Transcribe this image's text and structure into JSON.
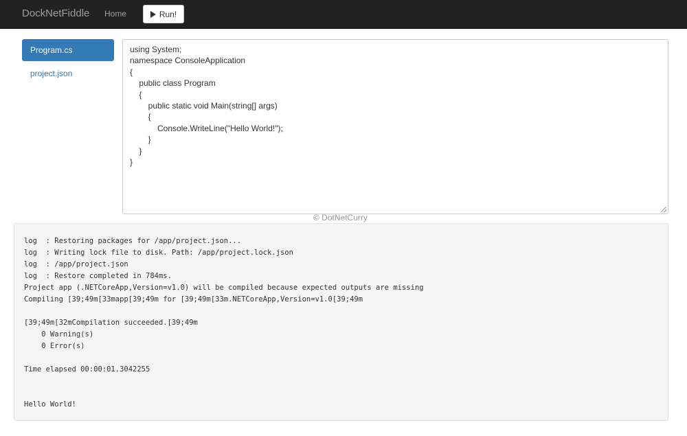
{
  "navbar": {
    "brand": "DockNetFiddle",
    "home_label": "Home",
    "run_label": "Run!"
  },
  "sidebar": {
    "files": [
      {
        "label": "Program.cs",
        "active": true
      },
      {
        "label": "project.json",
        "active": false
      }
    ]
  },
  "editor": {
    "lines": [
      "using System;",
      "namespace ConsoleApplication",
      "{",
      "    public class Program",
      "    {",
      "        public static void Main(string[] args)",
      "        {",
      "            Console.WriteLine(\"Hello World!\");",
      "        }",
      "    }",
      "}"
    ]
  },
  "watermark": "© DotNetCurry",
  "output": {
    "lines": [
      "log  : Restoring packages for /app/project.json...",
      "log  : Writing lock file to disk. Path: /app/project.lock.json",
      "log  : /app/project.json",
      "log  : Restore completed in 784ms.",
      "Project app (.NETCoreApp,Version=v1.0) will be compiled because expected outputs are missing",
      "Compiling [39;49m[33mapp[39;49m for [39;49m[33m.NETCoreApp,Version=v1.0[39;49m",
      "",
      "[39;49m[32mCompilation succeeded.[39;49m",
      "    0 Warning(s)",
      "    0 Error(s)",
      "",
      "Time elapsed 00:00:01.3042255",
      "",
      "",
      "Hello World!"
    ]
  }
}
